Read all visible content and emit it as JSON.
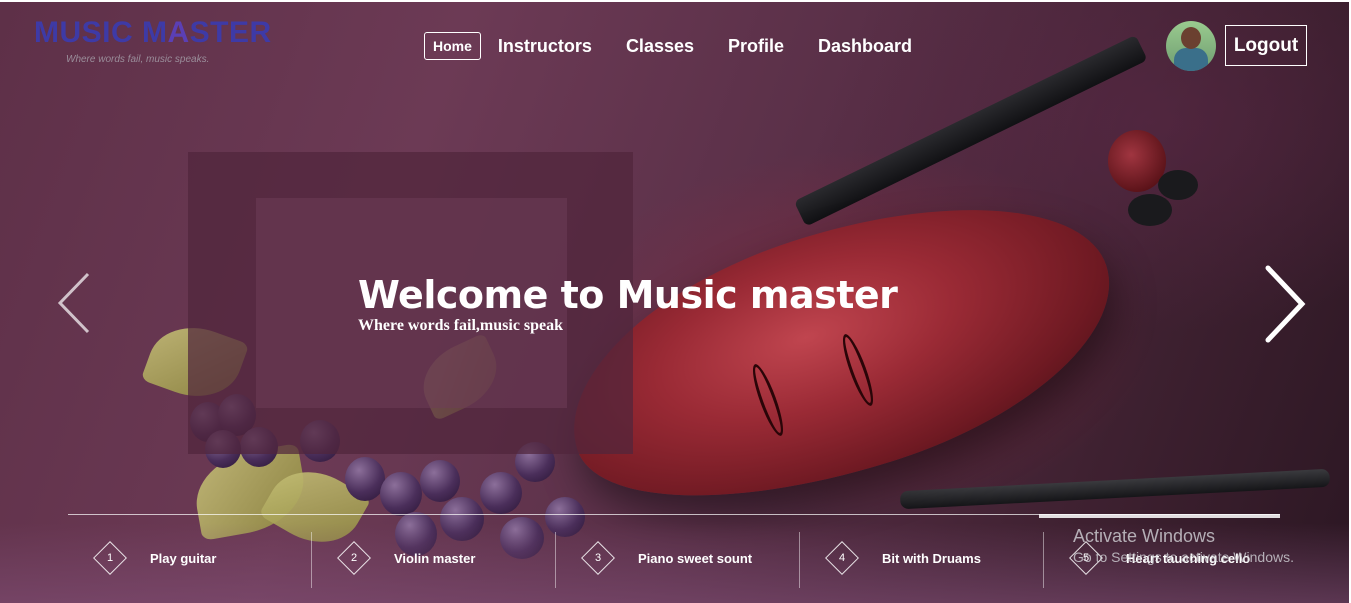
{
  "brand": {
    "logo_text_1": "MUSIC M",
    "logo_text_2": "A",
    "logo_text_3": "STER",
    "tagline": "Where words fail, music speaks."
  },
  "nav": {
    "items": [
      {
        "label": "Home",
        "active": true
      },
      {
        "label": "Instructors"
      },
      {
        "label": "Classes"
      },
      {
        "label": "Profile"
      },
      {
        "label": "Dashboard"
      }
    ],
    "logout_label": "Logout"
  },
  "hero": {
    "title": "Welcome to Music master",
    "subtitle": "Where words fail,music speak"
  },
  "slides": [
    {
      "number": "1",
      "title": "Play guitar"
    },
    {
      "number": "2",
      "title": "Violin master"
    },
    {
      "number": "3",
      "title": "Piano sweet sount"
    },
    {
      "number": "4",
      "title": "Bit with Druams"
    },
    {
      "number": "5",
      "title": "Heart tauching cello"
    }
  ],
  "watermark": {
    "title": "Activate Windows",
    "subtitle": "Go to Settings to activate Windows."
  },
  "colors": {
    "accent": "#3e3aa6",
    "text": "#ffffff"
  },
  "icons": {
    "prev": "chevron-left-icon",
    "next": "chevron-right-icon"
  }
}
